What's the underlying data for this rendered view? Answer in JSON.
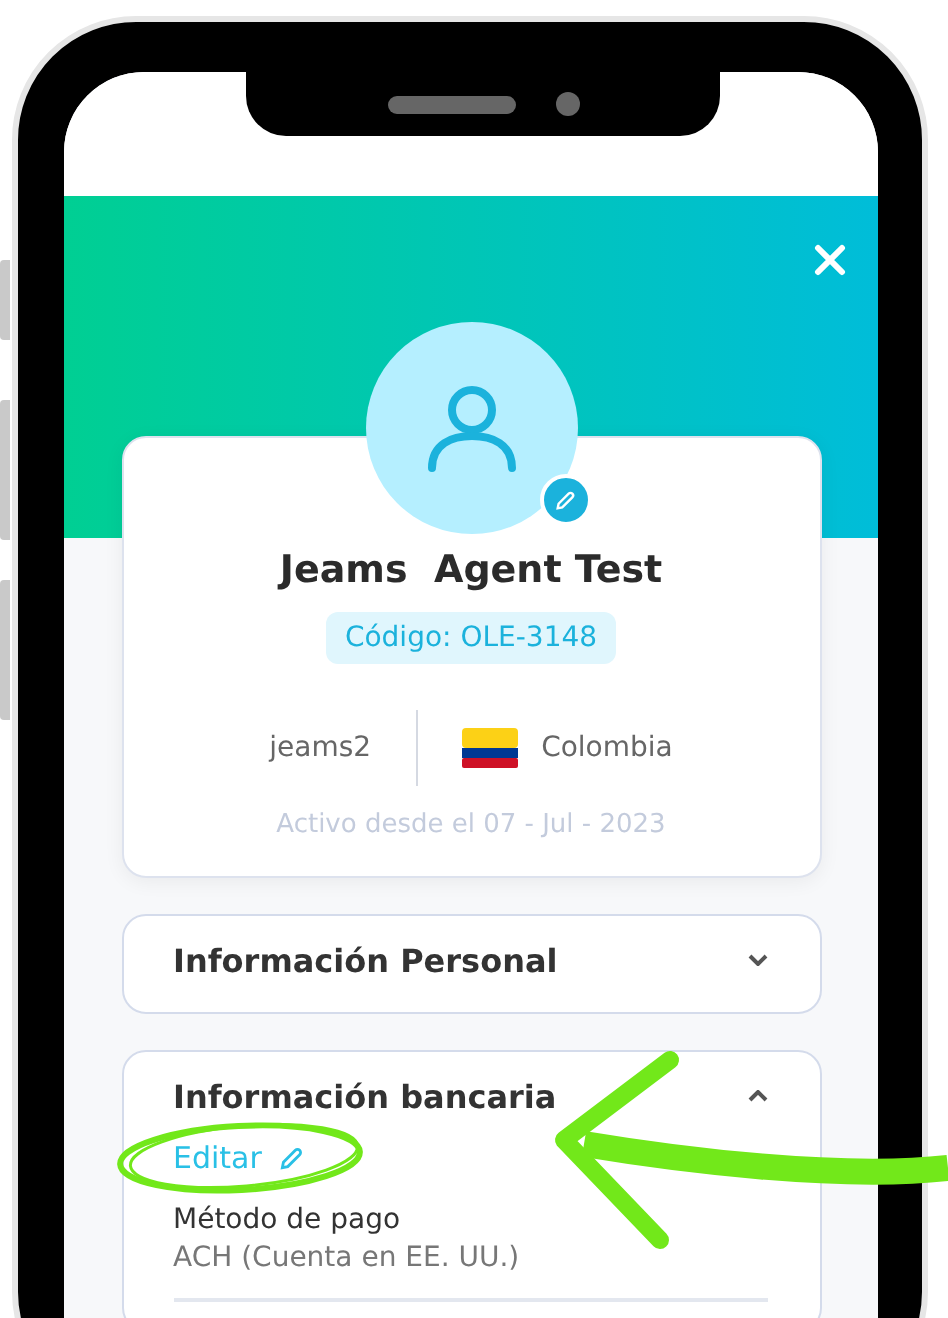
{
  "profile": {
    "name": "Jeams  Agent Test",
    "code": "Código: OLE-3148",
    "username": "jeams2",
    "country": "Colombia",
    "active_since": "Activo desde el 07 - Jul - 2023"
  },
  "sections": [
    {
      "title": "Información Personal",
      "expanded": false
    },
    {
      "title": "Información bancaria",
      "expanded": true,
      "edit_label": "Editar",
      "fields": [
        {
          "label": "Método de pago",
          "value": "ACH (Cuenta en EE. UU.)"
        }
      ]
    }
  ]
}
